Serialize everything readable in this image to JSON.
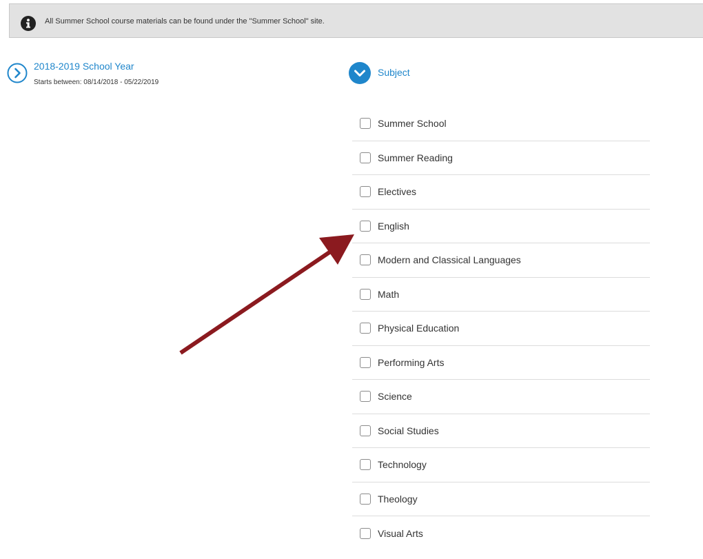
{
  "notice": {
    "icon": "info-icon",
    "text": "All Summer School course materials can be found under the \"Summer School\" site."
  },
  "school_year": {
    "icon": "chevron-right-circle-icon",
    "title": "2018-2019 School Year",
    "subtitle": "Starts between: 08/14/2018 - 05/22/2019",
    "expanded": false
  },
  "subject_filter": {
    "icon": "chevron-down-circle-icon",
    "title": "Subject",
    "expanded": true,
    "items": [
      {
        "label": "Summer School",
        "checked": false
      },
      {
        "label": "Summer Reading",
        "checked": false
      },
      {
        "label": "Electives",
        "checked": false
      },
      {
        "label": "English",
        "checked": false
      },
      {
        "label": "Modern and Classical Languages",
        "checked": false
      },
      {
        "label": "Math",
        "checked": false
      },
      {
        "label": "Physical Education",
        "checked": false
      },
      {
        "label": "Performing Arts",
        "checked": false
      },
      {
        "label": "Science",
        "checked": false
      },
      {
        "label": "Social Studies",
        "checked": false
      },
      {
        "label": "Technology",
        "checked": false
      },
      {
        "label": "Theology",
        "checked": false
      },
      {
        "label": "Visual Arts",
        "checked": false
      }
    ]
  },
  "annotation": {
    "icon": "arrow-annotation",
    "color": "#8b1a1f",
    "points_to": "English"
  },
  "colors": {
    "accent": "#1f86cb",
    "notice_bg": "#e2e2e2"
  }
}
